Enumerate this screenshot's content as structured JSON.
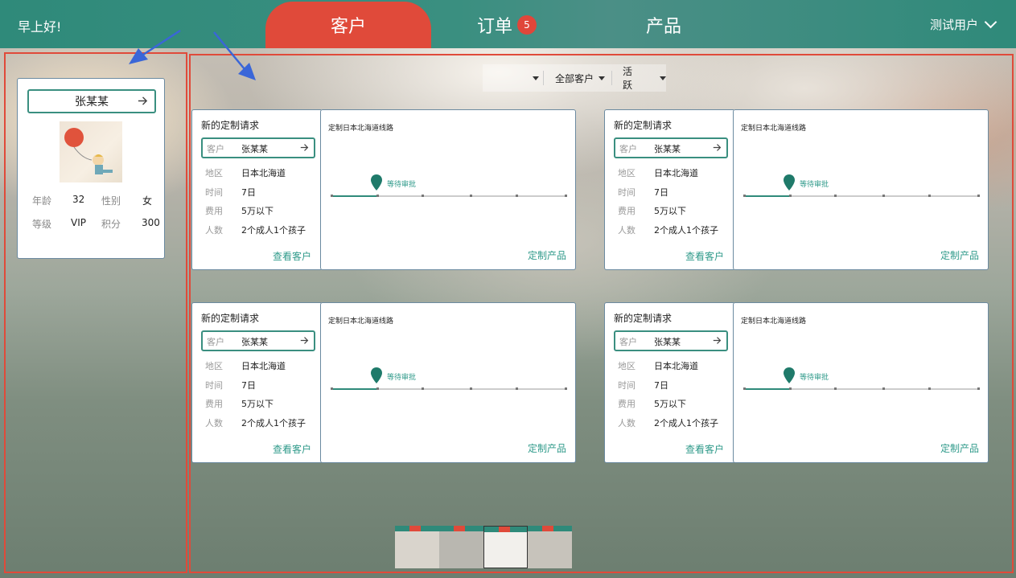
{
  "header": {
    "greeting": "早上好!",
    "tabs": [
      {
        "label": "客户",
        "active": true
      },
      {
        "label": "订单",
        "badge": "5"
      },
      {
        "label": "产品"
      }
    ],
    "user": "测试用户"
  },
  "profile": {
    "name": "张某某",
    "age_label": "年龄",
    "age": "32",
    "gender_label": "性别",
    "gender": "女",
    "level_label": "等级",
    "level": "VIP",
    "points_label": "积分",
    "points": "300"
  },
  "filters": {
    "first": "",
    "scope": "全部客户",
    "status": "活跃"
  },
  "cards": [
    {
      "title": "新的定制请求",
      "customer_label": "客户",
      "customer": "张某某",
      "region_label": "地区",
      "region": "日本北海道",
      "time_label": "时间",
      "time": "7日",
      "cost_label": "费用",
      "cost": "5万以下",
      "people_label": "人数",
      "people": "2个成人1个孩子",
      "view_link": "查看客户",
      "route": "定制日本北海道线路",
      "status": "等待审批",
      "custom_link": "定制产品"
    },
    {
      "title": "新的定制请求",
      "customer_label": "客户",
      "customer": "张某某",
      "region_label": "地区",
      "region": "日本北海道",
      "time_label": "时间",
      "time": "7日",
      "cost_label": "费用",
      "cost": "5万以下",
      "people_label": "人数",
      "people": "2个成人1个孩子",
      "view_link": "查看客户",
      "route": "定制日本北海道线路",
      "status": "等待审批",
      "custom_link": "定制产品"
    },
    {
      "title": "新的定制请求",
      "customer_label": "客户",
      "customer": "张某某",
      "region_label": "地区",
      "region": "日本北海道",
      "time_label": "时间",
      "time": "7日",
      "cost_label": "费用",
      "cost": "5万以下",
      "people_label": "人数",
      "people": "2个成人1个孩子",
      "view_link": "查看客户",
      "route": "定制日本北海道线路",
      "status": "等待审批",
      "custom_link": "定制产品"
    },
    {
      "title": "新的定制请求",
      "customer_label": "客户",
      "customer": "张某某",
      "region_label": "地区",
      "region": "日本北海道",
      "time_label": "时间",
      "time": "7日",
      "cost_label": "费用",
      "cost": "5万以下",
      "people_label": "人数",
      "people": "2个成人1个孩子",
      "view_link": "查看客户",
      "route": "定制日本北海道线路",
      "status": "等待审批",
      "custom_link": "定制产品"
    }
  ],
  "colors": {
    "accent": "#2f8a7a",
    "active_tab": "#e04a3a",
    "outline": "#e04a3a"
  }
}
